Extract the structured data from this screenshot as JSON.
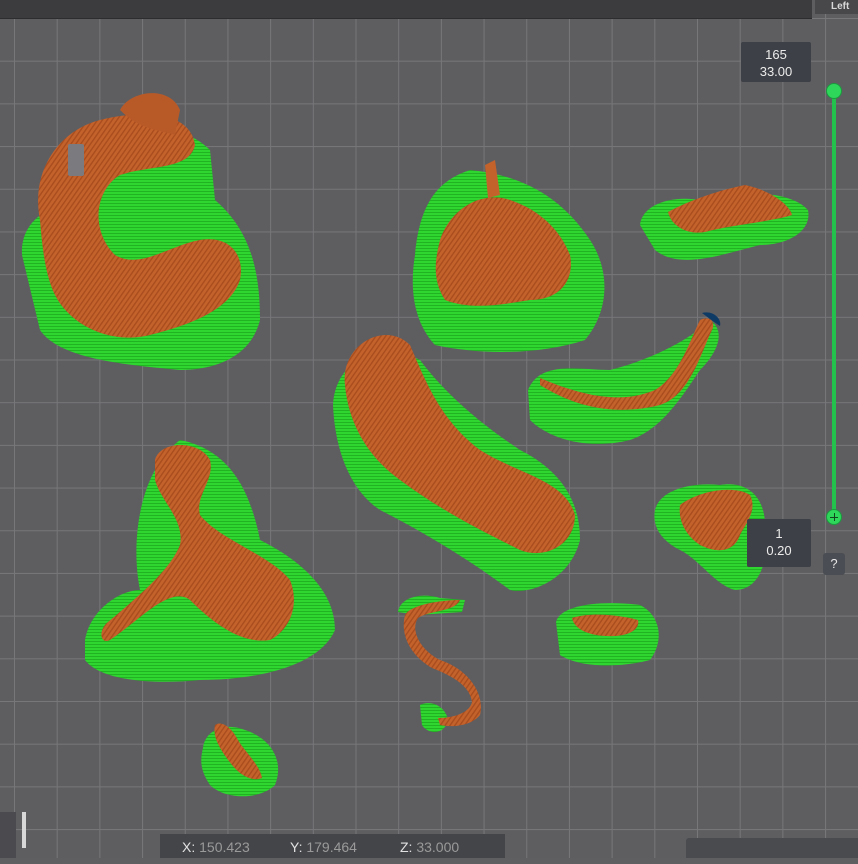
{
  "view": {
    "tab_label": "Left"
  },
  "layer_slider": {
    "top": {
      "layer": "165",
      "height": "33.00"
    },
    "bottom": {
      "layer": "1",
      "height": "0.20"
    },
    "help_label": "?"
  },
  "coordinates": {
    "x_label": "X:",
    "x_value": "150.423",
    "y_label": "Y:",
    "y_value": "179.464",
    "z_label": "Z:",
    "z_value": "33.000"
  },
  "colors": {
    "support": "#2fd62f",
    "model": "#c4622c",
    "slider_accent": "#2ed65a",
    "grid": "#777779",
    "background": "#5e5e61"
  },
  "icons": [
    "plate-icon",
    "slider-handle-icon"
  ]
}
